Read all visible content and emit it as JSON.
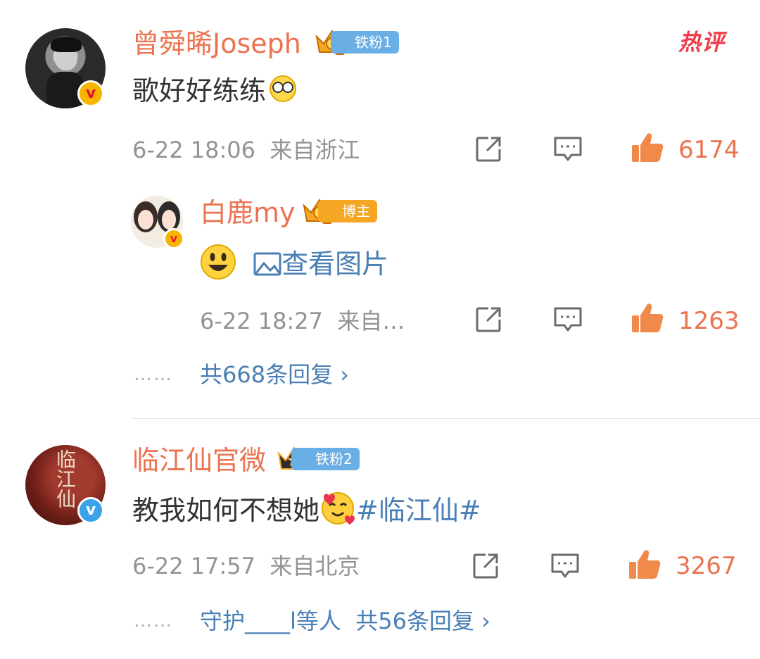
{
  "hot_label": "热评",
  "comments": [
    {
      "name": "曾舜晞Joseph",
      "badge": "铁粉1",
      "text": "歌好好练练",
      "time": "6-22 18:06",
      "location": "来自浙江",
      "likes": "6174",
      "reply": {
        "name": "白鹿my",
        "badge": "博主",
        "link": "查看图片",
        "time": "6-22 18:27",
        "location": "来自…",
        "likes": "1263"
      },
      "more_dots": "……",
      "more": "共668条回复 ›"
    },
    {
      "name": "临江仙官微",
      "badge": "铁粉2",
      "text": "教我如何不想她",
      "hashtag": "#临江仙#",
      "time": "6-22 17:57",
      "location": "来自北京",
      "likes": "3267",
      "more_dots": "……",
      "more_users": "守护____l等人",
      "more": "共56条回复 ›"
    }
  ],
  "avatar2_text": "临江仙",
  "colors": {
    "name": "#eb7350",
    "link": "#4a7fb5",
    "meta": "#939393",
    "like": "#eb7350"
  }
}
